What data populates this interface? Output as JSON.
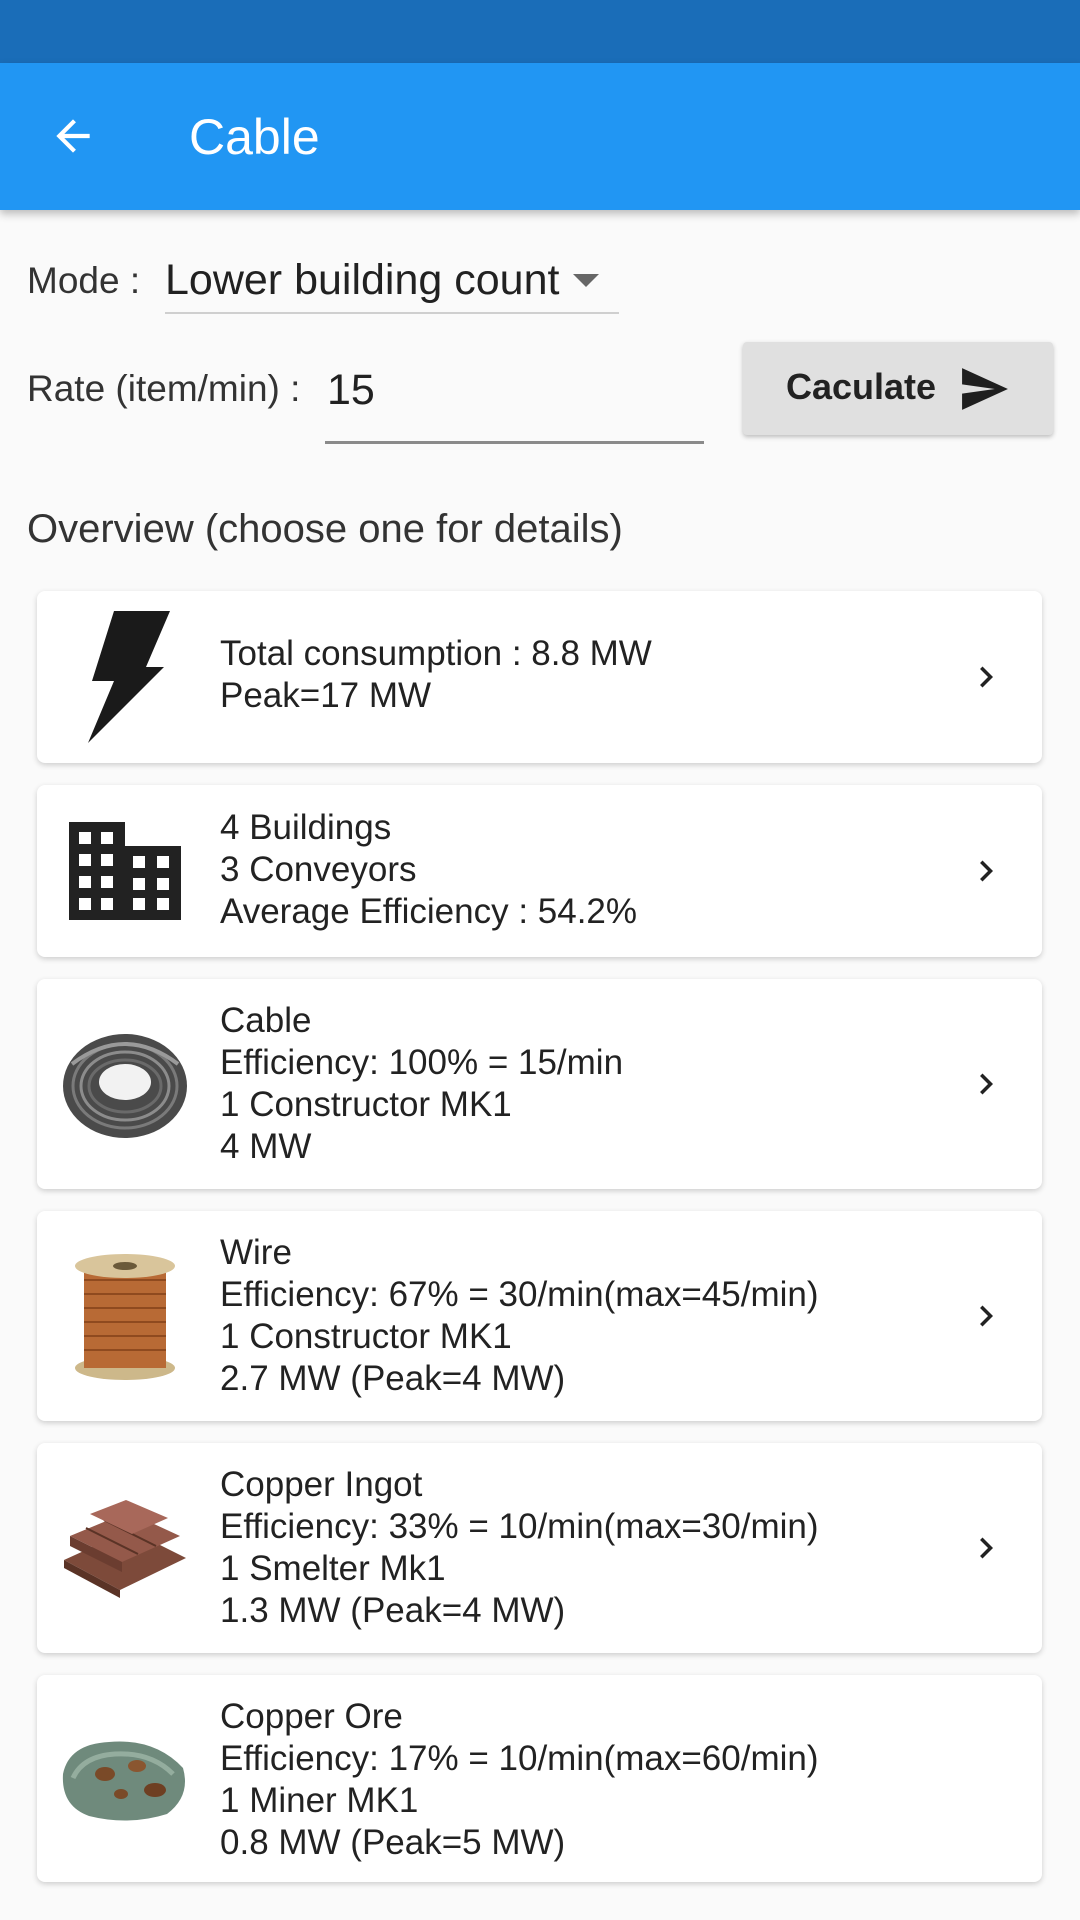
{
  "app_bar": {
    "title": "Cable",
    "back_icon": "arrow-back-icon"
  },
  "colors": {
    "status_bar": "#1a6db8",
    "app_bar": "#2196f3",
    "button_bg": "#e0e0e0"
  },
  "mode": {
    "label": "Mode :",
    "value": "Lower building count"
  },
  "rate": {
    "label": "Rate (item/min) :",
    "value": "15"
  },
  "calculate_button": {
    "label": "Caculate",
    "icon": "send-icon"
  },
  "overview": {
    "title": "Overview (choose one for details)",
    "cards": [
      {
        "icon": "lightning-icon",
        "lines": [
          "Total consumption : 8.8 MW",
          "Peak=17 MW"
        ]
      },
      {
        "icon": "building-icon",
        "lines": [
          "4 Buildings",
          "3 Conveyors",
          "Average Efficiency : 54.2%"
        ]
      },
      {
        "icon": "cable-coil-icon",
        "lines": [
          "Cable",
          "Efficiency: 100% = 15/min",
          "1 Constructor MK1",
          "4 MW"
        ]
      },
      {
        "icon": "wire-spool-icon",
        "lines": [
          "Wire",
          "Efficiency: 67% = 30/min(max=45/min)",
          "1 Constructor MK1",
          "2.7 MW (Peak=4 MW)"
        ]
      },
      {
        "icon": "copper-ingot-icon",
        "lines": [
          "Copper Ingot",
          "Efficiency: 33% = 10/min(max=30/min)",
          "1 Smelter Mk1",
          "1.3 MW (Peak=4 MW)"
        ]
      },
      {
        "icon": "copper-ore-icon",
        "lines": [
          "Copper Ore",
          "Efficiency: 17% = 10/min(max=60/min)",
          "1 Miner MK1",
          "0.8 MW (Peak=5 MW)"
        ]
      }
    ]
  }
}
